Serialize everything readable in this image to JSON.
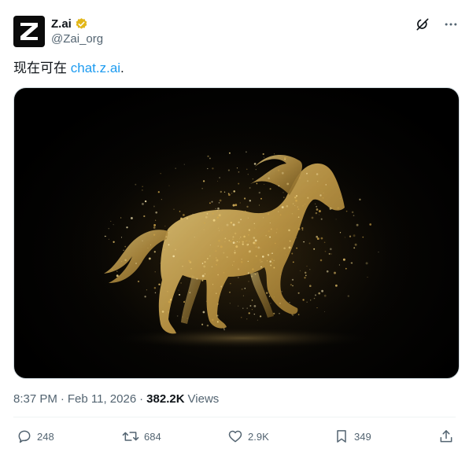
{
  "account": {
    "name": "Z.ai",
    "handle": "@Zai_org",
    "verified": true,
    "avatar_letter": "Z"
  },
  "icons": {
    "grok": "grok-icon",
    "more": "more-icon",
    "reply": "reply-icon",
    "repost": "repost-icon",
    "like": "like-icon",
    "bookmark": "bookmark-icon",
    "share": "share-icon"
  },
  "tweet": {
    "text_prefix": "现在可在 ",
    "link_text": "chat.z.ai",
    "text_suffix": "."
  },
  "media": {
    "subject": "golden-particle-horse"
  },
  "meta": {
    "time": "8:37 PM",
    "sep1": "·",
    "date": "Feb 11, 2026",
    "sep2": "·",
    "views_count": "382.2K",
    "views_label": "Views"
  },
  "actions": {
    "replies": "248",
    "reposts": "684",
    "likes": "2.9K",
    "bookmarks": "349"
  },
  "colors": {
    "accent": "#1d9bf0",
    "verified_gold": "#e2b719",
    "muted": "#536471",
    "text": "#0f1419"
  }
}
